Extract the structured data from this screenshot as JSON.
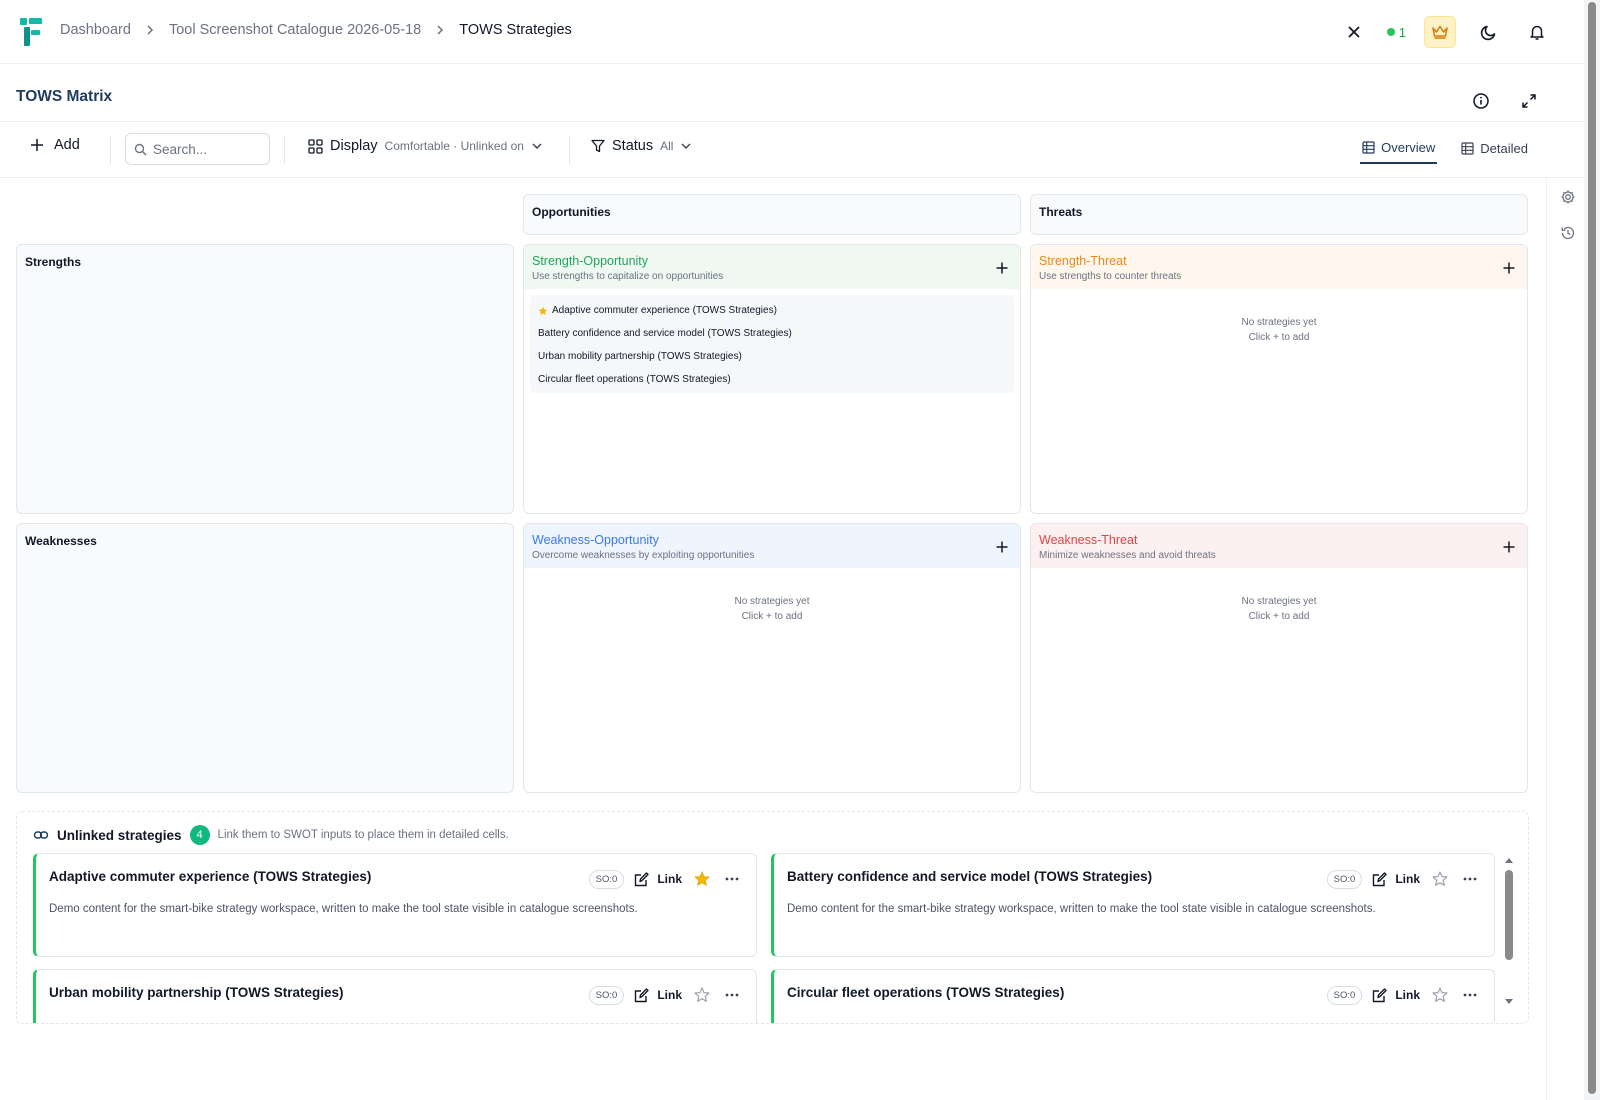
{
  "breadcrumb": [
    "Dashboard",
    "Tool Screenshot Catalogue 2026-05-18",
    "TOWS Strategies"
  ],
  "header": {
    "presence_count": "1"
  },
  "page": {
    "title": "TOWS Matrix"
  },
  "toolbar": {
    "add_label": "Add",
    "search_placeholder": "Search...",
    "display_label": "Display",
    "display_value": "Comfortable · Unlinked on",
    "status_label": "Status",
    "status_value": "All",
    "tabs": [
      {
        "label": "Overview",
        "active": true
      },
      {
        "label": "Detailed",
        "active": false
      }
    ]
  },
  "matrix": {
    "columns": [
      "Opportunities",
      "Threats"
    ],
    "rows": [
      "Strengths",
      "Weaknesses"
    ],
    "cells": {
      "so": {
        "title": "Strength-Opportunity",
        "desc": "Use strengths to capitalize on opportunities",
        "color": "#22a45d",
        "items": [
          {
            "label": "Adaptive commuter experience (TOWS Strategies)",
            "starred": true
          },
          {
            "label": "Battery confidence and service model (TOWS Strategies)",
            "starred": false
          },
          {
            "label": "Urban mobility partnership (TOWS Strategies)",
            "starred": false
          },
          {
            "label": "Circular fleet operations (TOWS Strategies)",
            "starred": false
          }
        ]
      },
      "st": {
        "title": "Strength-Threat",
        "desc": "Use strengths to counter threats",
        "color": "#ea8a14",
        "empty_line1": "No strategies yet",
        "empty_line2": "Click + to add"
      },
      "wo": {
        "title": "Weakness-Opportunity",
        "desc": "Overcome weaknesses by exploiting opportunities",
        "color": "#3b7be0",
        "empty_line1": "No strategies yet",
        "empty_line2": "Click + to add"
      },
      "wt": {
        "title": "Weakness-Threat",
        "desc": "Minimize weaknesses and avoid threats",
        "color": "#e04444",
        "empty_line1": "No strategies yet",
        "empty_line2": "Click + to add"
      }
    }
  },
  "unlinked": {
    "title": "Unlinked strategies",
    "count": "4",
    "hint": "Link them to SWOT inputs to place them in detailed cells.",
    "cards": [
      {
        "title": "Adaptive commuter experience (TOWS Strategies)",
        "pill": "SO:0",
        "link_label": "Link",
        "starred": true,
        "body": "Demo content for the smart-bike strategy workspace, written to make the tool state visible in catalogue screenshots."
      },
      {
        "title": "Battery confidence and service model (TOWS Strategies)",
        "pill": "SO:0",
        "link_label": "Link",
        "starred": false,
        "body": "Demo content for the smart-bike strategy workspace, written to make the tool state visible in catalogue screenshots."
      },
      {
        "title": "Urban mobility partnership (TOWS Strategies)",
        "pill": "SO:0",
        "link_label": "Link",
        "starred": false,
        "body": ""
      },
      {
        "title": "Circular fleet operations (TOWS Strategies)",
        "pill": "SO:0",
        "link_label": "Link",
        "starred": false,
        "body": ""
      }
    ]
  },
  "colors": {
    "accent": "#1e3a5f",
    "success": "#22c55e",
    "star": "#f2b705",
    "crown_bg": "#fef3c7"
  }
}
